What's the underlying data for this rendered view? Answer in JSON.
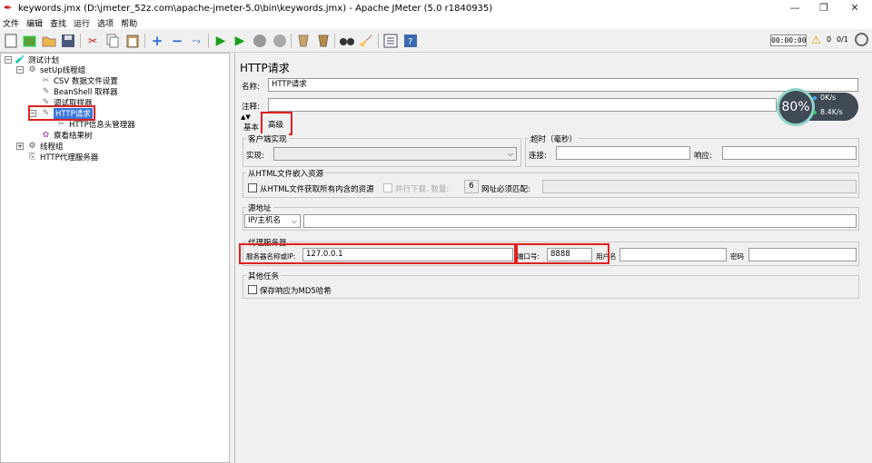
{
  "window": {
    "title": "keywords.jmx (D:\\jmeter_52z.com\\apache-jmeter-5.0\\bin\\keywords.jmx) - Apache JMeter (5.0 r1840935)",
    "minimize": "—",
    "maximize": "❐",
    "close": "✕"
  },
  "menu": [
    "文件",
    "编辑",
    "查找",
    "运行",
    "选项",
    "帮助"
  ],
  "toolbar": {
    "timer": "00:00:00",
    "warning_count": "0",
    "threads": "0/1"
  },
  "tree": {
    "root": "测试计划",
    "setup_group": "setUp线程组",
    "csv": "CSV 数据文件设置",
    "beanshell": "BeanShell 取样器",
    "debug": "调试取样器",
    "http_request": "HTTP请求",
    "header_manager": "HTTP信息头管理器",
    "results_tree": "察看结果树",
    "thread_group": "线程组",
    "proxy": "HTTP代理服务器"
  },
  "panel": {
    "title": "HTTP请求",
    "name_label": "名称:",
    "name_value": "HTTP请求",
    "comment_label": "注释:",
    "tab_basic": "基本",
    "tab_advanced": "高级",
    "client_impl": {
      "title": "客户端实现",
      "impl_label": "实现:"
    },
    "timeout": {
      "title": "超时（毫秒）",
      "connect_label": "连接:",
      "response_label": "响应:"
    },
    "embedded": {
      "title": "从HTML文件嵌入资源",
      "retrieve_all": "从HTML文件获取所有内含的资源",
      "parallel": "并行下载. 数量:",
      "parallel_count": "6",
      "url_match": "网址必须匹配:"
    },
    "source": {
      "title": "源地址",
      "type": "IP/主机名"
    },
    "proxy": {
      "title": "代理服务器",
      "server_label": "服务器名称或IP:",
      "server_value": "127.0.0.1",
      "port_label": "端口号:",
      "port_value": "8888",
      "user_label": "用户名",
      "pass_label": "密码"
    },
    "other": {
      "title": "其他任务",
      "save_md5": "保存响应为MD5哈希"
    }
  },
  "netmon": {
    "percent": "80%",
    "upload": "0K/s",
    "download": "8.4K/s"
  }
}
